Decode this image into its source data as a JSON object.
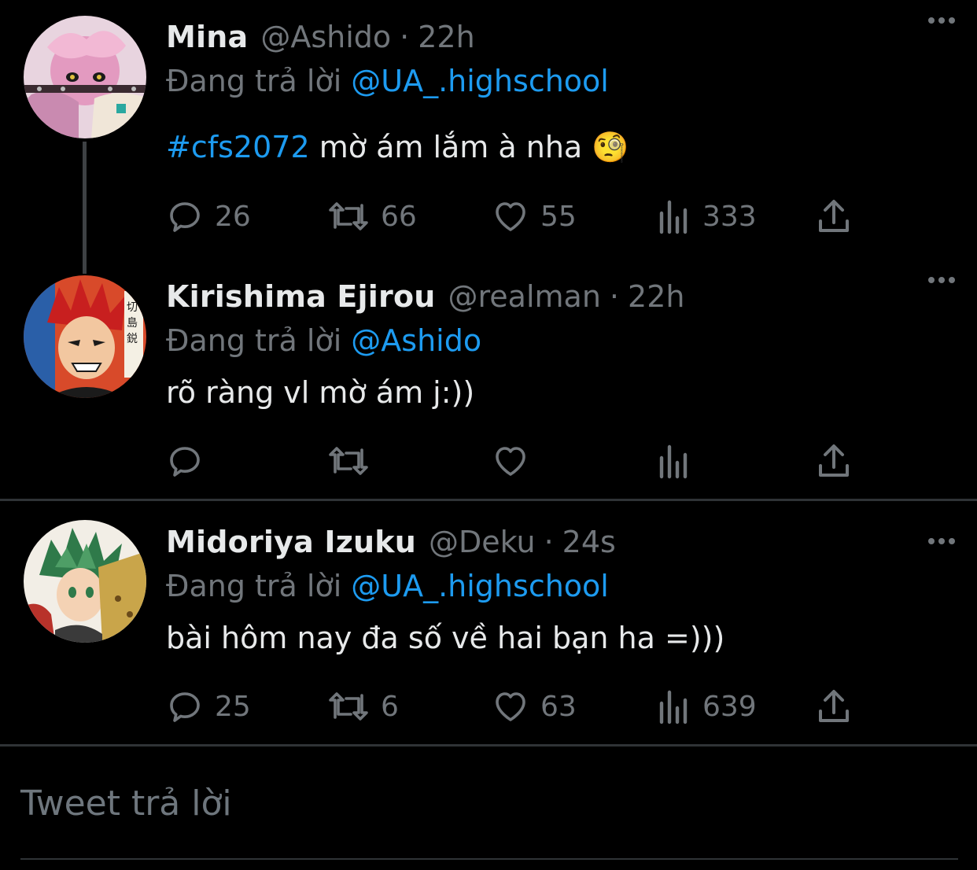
{
  "tweets": [
    {
      "name": "Mina",
      "handle": "@Ashido",
      "separator": "·",
      "time": "22h",
      "reply_prefix": "Đang trả lời",
      "reply_to": "@UA_.highschool",
      "hashtag": "#cfs2072",
      "text": "mờ ám lắm à nha",
      "emoji": "🧐",
      "counts": {
        "reply": "26",
        "retweet": "66",
        "like": "55",
        "views": "333"
      }
    },
    {
      "name": "Kirishima Ejirou",
      "handle": "@realman",
      "separator": "·",
      "time": "22h",
      "reply_prefix": "Đang trả lời",
      "reply_to": "@Ashido",
      "text": "rõ ràng vl mờ ám j:))",
      "counts": {
        "reply": "",
        "retweet": "",
        "like": "",
        "views": ""
      }
    },
    {
      "name": "Midoriya Izuku",
      "handle": "@Deku",
      "separator": "·",
      "time": "24s",
      "reply_prefix": "Đang trả lời",
      "reply_to": "@UA_.highschool",
      "text": "bài hôm nay đa số về hai bạn ha =)))",
      "counts": {
        "reply": "25",
        "retweet": "6",
        "like": "63",
        "views": "639"
      }
    }
  ],
  "compose": {
    "placeholder": "Tweet trả lời"
  },
  "icons": {
    "reply": "reply-icon",
    "retweet": "retweet-icon",
    "like": "heart-icon",
    "views": "views-icon",
    "share": "share-icon",
    "more": "more-icon"
  },
  "colors": {
    "background": "#000000",
    "text": "#e7e9ea",
    "muted": "#71767b",
    "link": "#1d9bf0",
    "divider": "#2f3336"
  }
}
